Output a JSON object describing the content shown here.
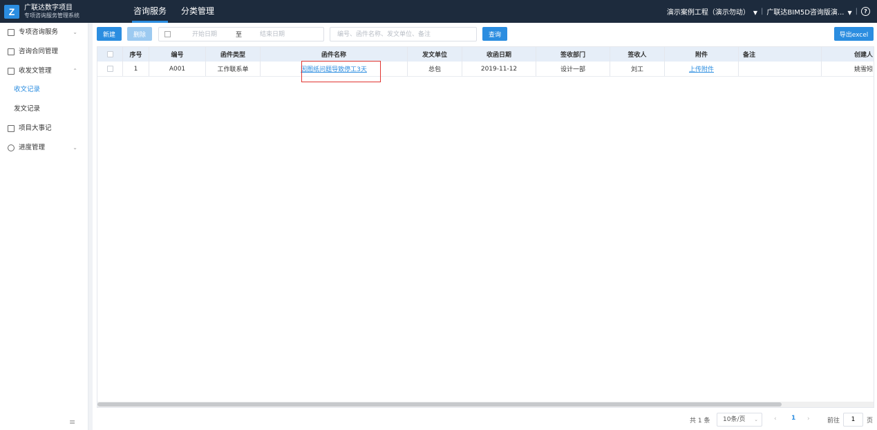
{
  "header": {
    "logo_letter": "Z",
    "brand_title": "广联达数字项目",
    "brand_subtitle": "专项咨询服务管理系统",
    "tabs": [
      {
        "label": "咨询服务",
        "active": true
      },
      {
        "label": "分类管理",
        "active": false
      }
    ],
    "project_selector": "演示案例工程（演示勿动）",
    "org_selector": "广联达BIM5D咨询版演...",
    "help_glyph": "?",
    "caret_glyph": "▼",
    "separator": "|"
  },
  "sidebar": {
    "items": [
      {
        "label": "专项咨询服务",
        "icon": "document-icon",
        "caret": "⌄"
      },
      {
        "label": "咨询合同管理",
        "icon": "contract-icon"
      },
      {
        "label": "收发文管理",
        "icon": "mail-icon",
        "caret": "⌃"
      },
      {
        "label": "收文记录",
        "sub": true,
        "active": true
      },
      {
        "label": "发文记录",
        "sub": true
      },
      {
        "label": "项目大事记",
        "icon": "notebook-icon"
      },
      {
        "label": "进度管理",
        "icon": "clock-icon",
        "caret": "⌄"
      }
    ],
    "collapse_glyph": "≡"
  },
  "toolbar": {
    "new_label": "新建",
    "delete_label": "删除",
    "start_date_placeholder": "开始日期",
    "range_separator": "至",
    "end_date_placeholder": "结束日期",
    "search_placeholder": "编号、函件名称、发文单位、备注",
    "query_label": "查询",
    "export_label": "导出excel"
  },
  "table": {
    "columns": [
      "序号",
      "编号",
      "函件类型",
      "函件名称",
      "发文单位",
      "收函日期",
      "签收部门",
      "签收人",
      "附件",
      "备注",
      "创建人"
    ],
    "rows": [
      {
        "index": "1",
        "code": "A001",
        "type": "工作联系单",
        "name": "因图纸问题导致停工3天",
        "sender": "总包",
        "date": "2019-11-12",
        "dept": "设计一部",
        "receiver": "刘工",
        "attachment": "上传附件",
        "remark": "",
        "creator": "姚雪矧"
      }
    ]
  },
  "pagination": {
    "total": "共 1 条",
    "page_size": "10条/页",
    "prev": "‹",
    "current": "1",
    "next": "›",
    "goto_label": "前往",
    "goto_value": "1",
    "unit": "页"
  },
  "colors": {
    "accent": "#2b8de0",
    "topbar": "#1d2b3d",
    "highlight": "#e0332f"
  }
}
